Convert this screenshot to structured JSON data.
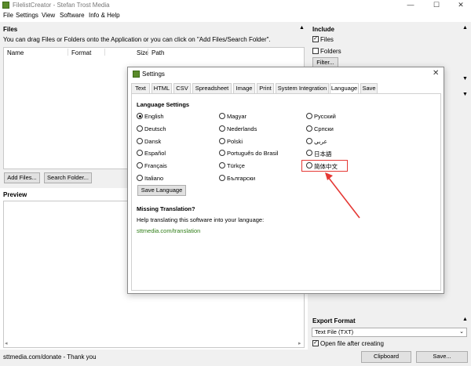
{
  "window": {
    "title": "FilelistCreator - Stefan Trost Media",
    "minimize": "—",
    "maximize": "☐",
    "close": "✕"
  },
  "menu": [
    "File",
    "Settings",
    "View",
    "Software",
    "Info & Help"
  ],
  "files": {
    "title": "Files",
    "hint": "You can drag Files or Folders onto the Application or you can click on \"Add Files/Search Folder\".",
    "columns": [
      "Name",
      "Format",
      "Size",
      "Path"
    ],
    "add_files": "Add Files...",
    "search_folder": "Search Folder..."
  },
  "preview": {
    "title": "Preview"
  },
  "include": {
    "title": "Include",
    "files_label": "Files",
    "folders_label": "Folders",
    "filter_button": "Filter..."
  },
  "export": {
    "title": "Export Format",
    "format_value": "Text File (TXT)",
    "open_after_label": "Open file after creating",
    "clipboard": "Clipboard",
    "save": "Save..."
  },
  "status": {
    "text": "sttmedia.com/donate - Thank you"
  },
  "dialog": {
    "title": "Settings",
    "close": "✕",
    "tabs": [
      "Text",
      "HTML",
      "CSV",
      "Spreadsheet",
      "Image",
      "Print",
      "System Integration",
      "Language",
      "Save"
    ],
    "active_tab": "Language",
    "language_heading": "Language Settings",
    "languages_col1": [
      "English",
      "Deutsch",
      "Dansk",
      "Español",
      "Français",
      "Italiano"
    ],
    "languages_col2": [
      "Magyar",
      "Nederlands",
      "Polski",
      "Português do Brasil",
      "Türkçe",
      "Български"
    ],
    "languages_col3": [
      "Русский",
      "Српски",
      "عربي",
      "日本語",
      "简体中文"
    ],
    "selected_language": "English",
    "save_language": "Save Language",
    "missing_heading": "Missing Translation?",
    "missing_text": "Help translating this software into your language:",
    "missing_link": "sttmedia.com/translation"
  },
  "colors": {
    "annotation": "#e53935",
    "link": "#2e7d16"
  }
}
